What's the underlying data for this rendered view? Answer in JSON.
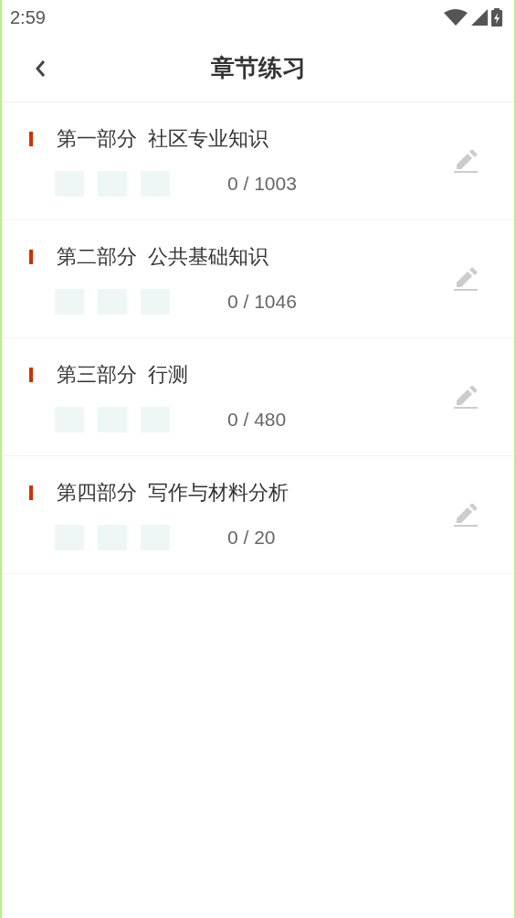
{
  "status_bar": {
    "time": "2:59"
  },
  "header": {
    "title": "章节练习"
  },
  "chapters": [
    {
      "part": "第一部分",
      "name": "社区专业知识",
      "progress": "0 / 1003"
    },
    {
      "part": "第二部分",
      "name": "公共基础知识",
      "progress": "0 / 1046"
    },
    {
      "part": "第三部分",
      "name": "行测",
      "progress": "0 / 480"
    },
    {
      "part": "第四部分",
      "name": "写作与材料分析",
      "progress": "0 / 20"
    }
  ]
}
